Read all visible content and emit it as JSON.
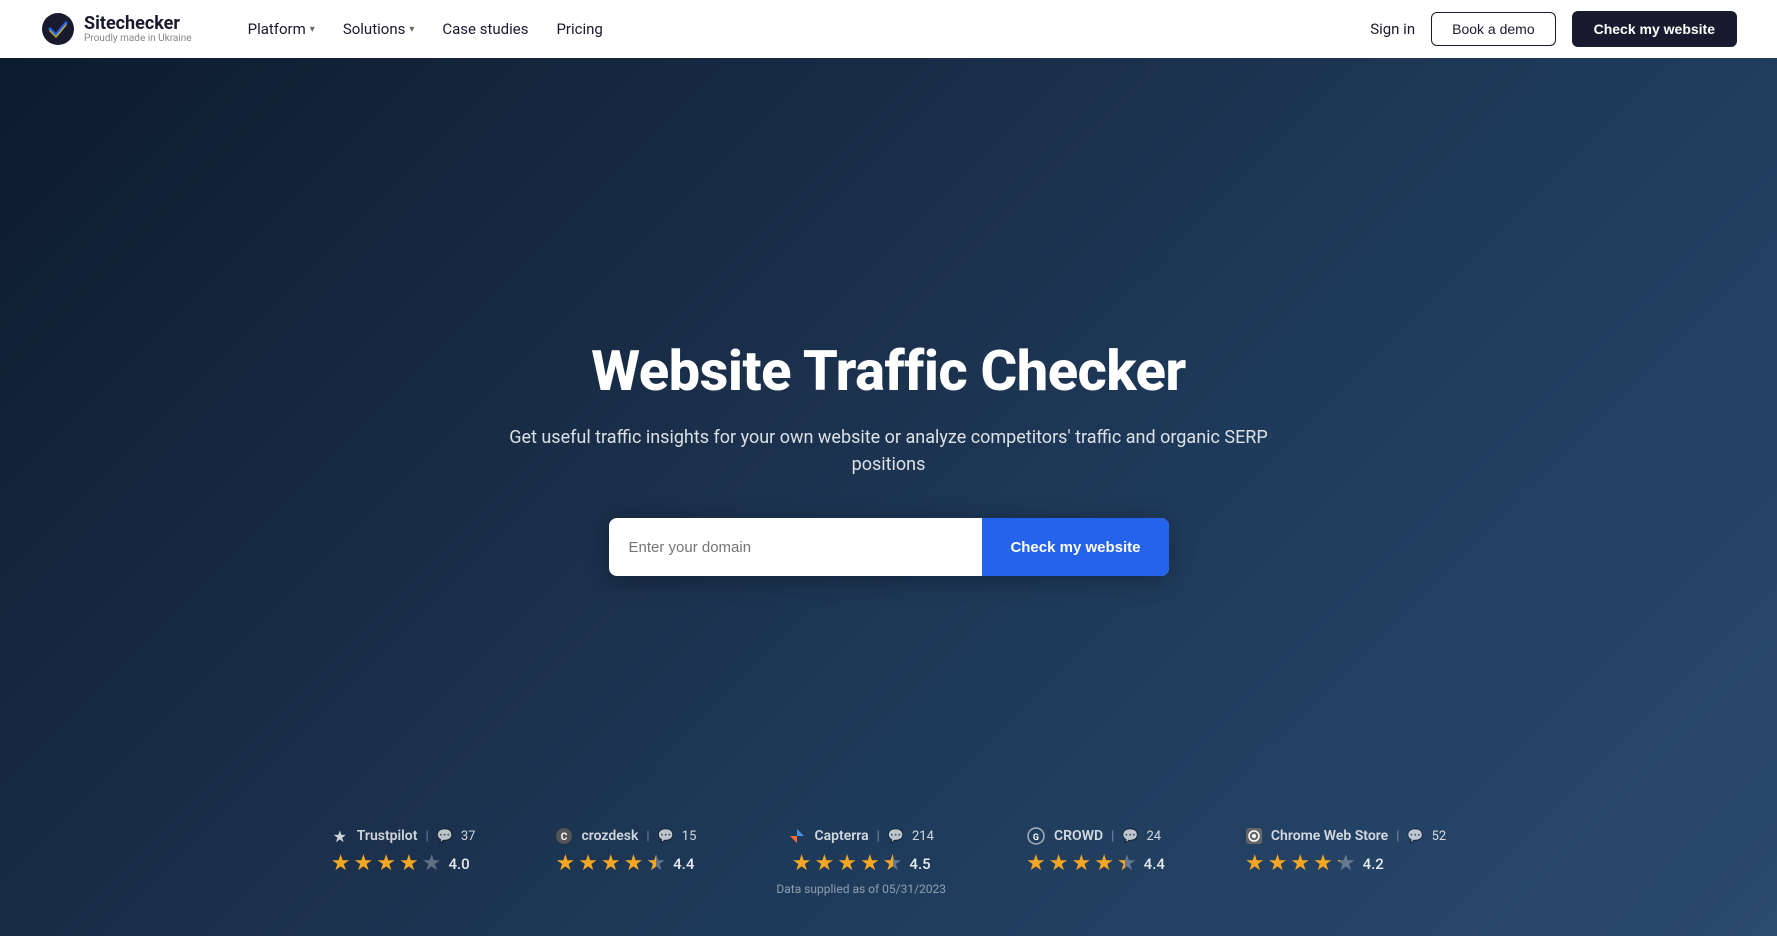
{
  "nav": {
    "logo_name": "Sitechecker",
    "logo_sub": "Proudly made in Ukraine",
    "links": [
      {
        "label": "Platform",
        "has_dropdown": true
      },
      {
        "label": "Solutions",
        "has_dropdown": true
      },
      {
        "label": "Case studies",
        "has_dropdown": false
      },
      {
        "label": "Pricing",
        "has_dropdown": false
      }
    ],
    "sign_in": "Sign in",
    "book_demo": "Book a demo",
    "check_website": "Check my website"
  },
  "hero": {
    "title": "Website Traffic Checker",
    "subtitle": "Get useful traffic insights for your own website or analyze competitors' traffic and organic SERP positions",
    "input_placeholder": "Enter your domain",
    "cta_button": "Check my website"
  },
  "ratings": [
    {
      "name": "Trustpilot",
      "icon_type": "star",
      "count": "37",
      "stars": 4.0,
      "score": "4.0"
    },
    {
      "name": "crozdesk",
      "icon_type": "c",
      "count": "15",
      "stars": 4.4,
      "score": "4.4"
    },
    {
      "name": "Capterra",
      "icon_type": "arrow",
      "count": "214",
      "stars": 4.5,
      "score": "4.5",
      "data_supplied": "Data supplied as of 05/31/2023"
    },
    {
      "name": "CROWD",
      "icon_type": "g",
      "count": "24",
      "stars": 4.4,
      "score": "4.4"
    },
    {
      "name": "Chrome Web Store",
      "icon_type": "chrome",
      "count": "52",
      "stars": 4.2,
      "score": "4.2"
    }
  ],
  "colors": {
    "nav_bg": "#ffffff",
    "hero_bg_start": "#0d1b2e",
    "hero_bg_end": "#2a4a6e",
    "cta_bg": "#2563eb",
    "star_color": "#f5a623",
    "dark_btn": "#1a1a2e"
  }
}
